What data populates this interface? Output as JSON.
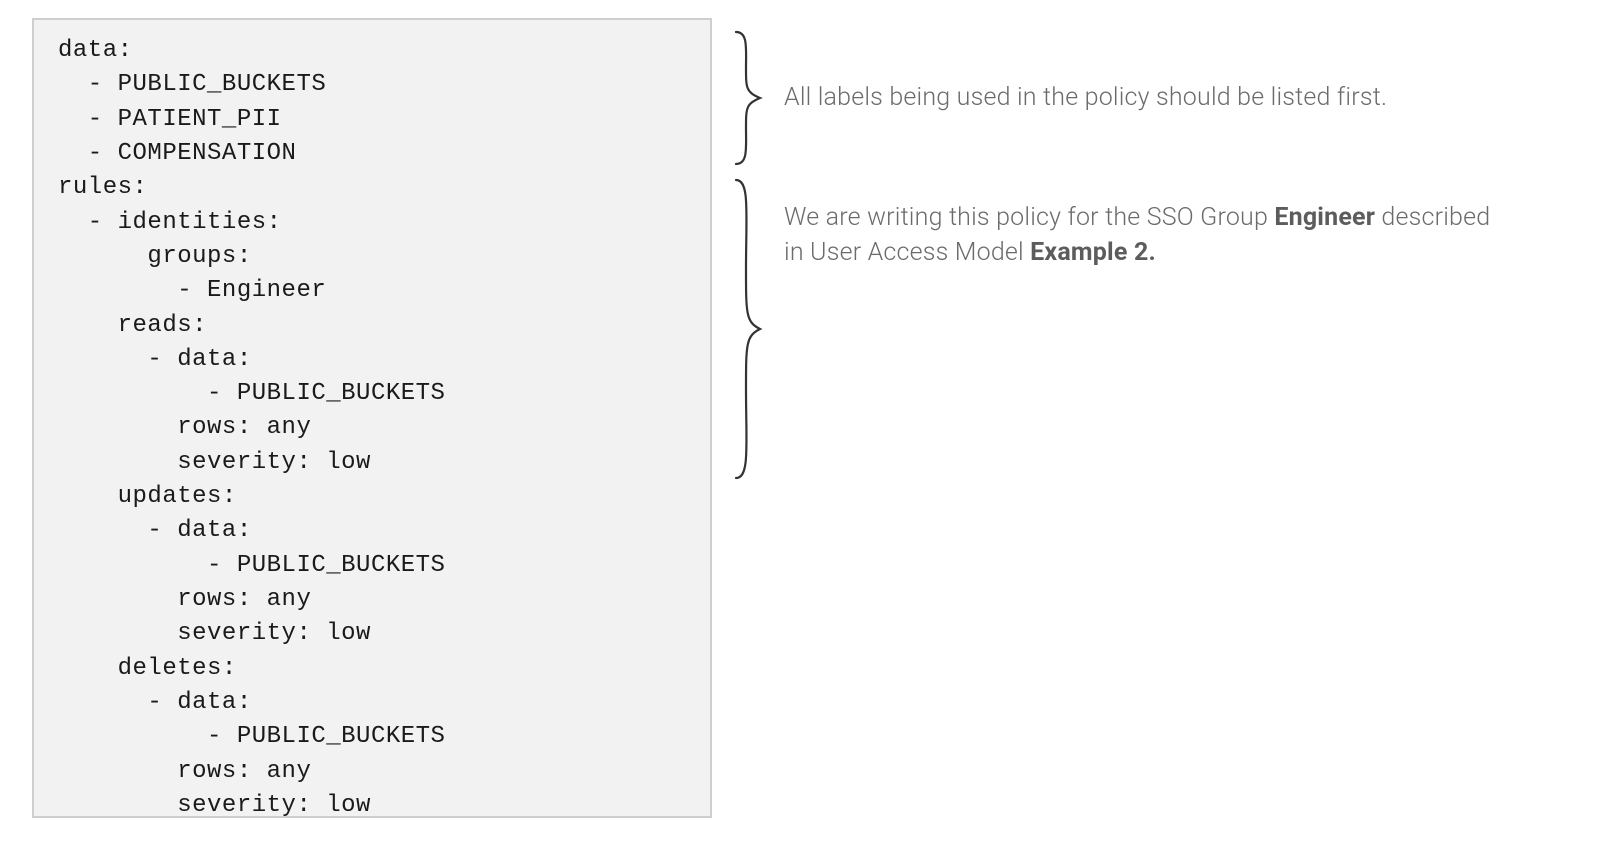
{
  "codeLines": [
    "data:",
    "  - PUBLIC_BUCKETS",
    "  - PATIENT_PII",
    "  - COMPENSATION",
    "rules:",
    "  - identities:",
    "      groups:",
    "        - Engineer",
    "    reads:",
    "      - data:",
    "          - PUBLIC_BUCKETS",
    "        rows: any",
    "        severity: low",
    "    updates:",
    "      - data:",
    "          - PUBLIC_BUCKETS",
    "        rows: any",
    "        severity: low",
    "    deletes:",
    "      - data:",
    "          - PUBLIC_BUCKETS",
    "        rows: any",
    "        severity: low"
  ],
  "annotation1": {
    "text": "All labels being used in the policy should be listed first."
  },
  "annotation2": {
    "prefix": "We are writing this policy for the SSO Group ",
    "boldA": "Engineer",
    "midA": " described in User Access Model ",
    "boldB": "Example 2."
  }
}
